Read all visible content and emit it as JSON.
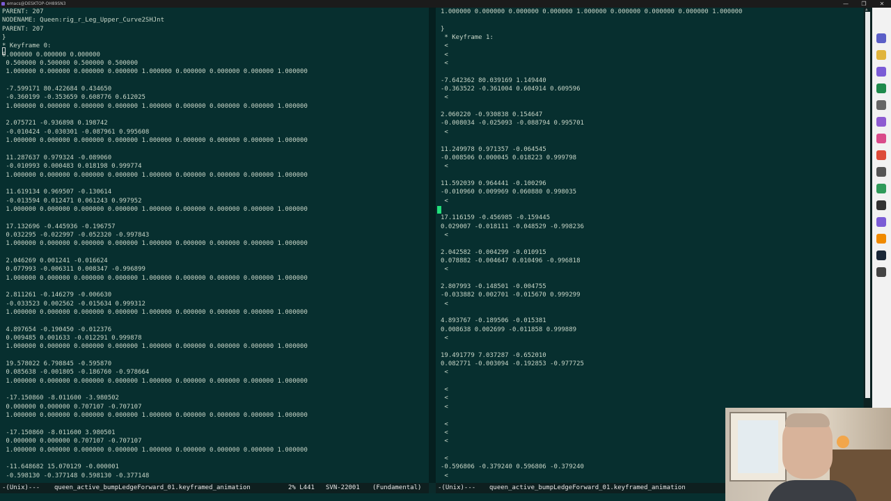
{
  "window": {
    "title": "emacs@DESKTOP-OH89SN3",
    "controls": [
      "—",
      "❐",
      "✕"
    ]
  },
  "left_pane": {
    "lines": [
      "PARENT: 207",
      "NODENAME: Queen:rig_r_Leg_Upper_Curve2SHJnt",
      "PARENT: 207",
      "}",
      "* Keyframe 0:",
      "0.000000 0.000000 0.000000",
      " 0.500000 0.500000 0.500000 0.500000",
      " 1.000000 0.000000 0.000000 0.000000 1.000000 0.000000 0.000000 0.000000 1.000000",
      "",
      " -7.599171 80.422684 0.434650",
      " -0.360199 -0.353659 0.608776 0.612025",
      " 1.000000 0.000000 0.000000 0.000000 1.000000 0.000000 0.000000 0.000000 1.000000",
      "",
      " 2.075721 -0.936898 0.198742",
      " -0.010424 -0.030301 -0.087961 0.995608",
      " 1.000000 0.000000 0.000000 0.000000 1.000000 0.000000 0.000000 0.000000 1.000000",
      "",
      " 11.287637 0.979324 -0.089060",
      " -0.010993 0.000483 0.018198 0.999774",
      " 1.000000 0.000000 0.000000 0.000000 1.000000 0.000000 0.000000 0.000000 1.000000",
      "",
      " 11.619134 0.969507 -0.130614",
      " -0.013594 0.012471 0.061243 0.997952",
      " 1.000000 0.000000 0.000000 0.000000 1.000000 0.000000 0.000000 0.000000 1.000000",
      "",
      " 17.132696 -0.445936 -0.196757",
      " 0.032295 -0.022997 -0.052320 -0.997843",
      " 1.000000 0.000000 0.000000 0.000000 1.000000 0.000000 0.000000 0.000000 1.000000",
      "",
      " 2.046269 0.001241 -0.016624",
      " 0.077993 -0.006311 0.008347 -0.996899",
      " 1.000000 0.000000 0.000000 0.000000 1.000000 0.000000 0.000000 0.000000 1.000000",
      "",
      " 2.811261 -0.146279 -0.006630",
      " -0.033523 0.002562 -0.015634 0.999312",
      " 1.000000 0.000000 0.000000 0.000000 1.000000 0.000000 0.000000 0.000000 1.000000",
      "",
      " 4.897654 -0.190450 -0.012376",
      " 0.009485 0.001633 -0.012291 0.999878",
      " 1.000000 0.000000 0.000000 0.000000 1.000000 0.000000 0.000000 0.000000 1.000000",
      "",
      " 19.578022 6.798845 -0.595870",
      " 0.085638 -0.001805 -0.186760 -0.978664",
      " 1.000000 0.000000 0.000000 0.000000 1.000000 0.000000 0.000000 0.000000 1.000000",
      "",
      " -17.150860 -8.011600 -3.980502",
      " 0.000000 0.000000 0.707107 -0.707107",
      " 1.000000 0.000000 0.000000 0.000000 1.000000 0.000000 0.000000 0.000000 1.000000",
      "",
      " -17.150860 -8.011600 3.980501",
      " 0.000000 0.000000 0.707107 -0.707107",
      " 1.000000 0.000000 0.000000 0.000000 1.000000 0.000000 0.000000 0.000000 1.000000",
      "",
      " -11.648682 15.070129 -0.000001",
      " -0.598130 -0.377148 0.598130 -0.377148"
    ]
  },
  "right_pane": {
    "lines": [
      "1.000000 0.000000 0.000000 0.000000 1.000000 0.000000 0.000000 0.000000 1.000000",
      "",
      "}",
      " * Keyframe 1:",
      " <",
      " <",
      " <",
      "",
      "-7.642362 80.039169 1.149440",
      "-0.363522 -0.361004 0.604914 0.609596",
      " <",
      "",
      "2.060220 -0.930838 0.154647",
      "-0.008034 -0.025093 -0.088794 0.995701",
      " <",
      "",
      "11.249978 0.971357 -0.064545",
      "-0.008506 0.000045 0.018223 0.999798",
      " <",
      "",
      "11.592039 0.964441 -0.100296",
      "-0.010960 0.009969 0.060880 0.998035",
      " <",
      "",
      "17.116159 -0.456985 -0.159445",
      "0.029007 -0.018111 -0.048529 -0.998236",
      " <",
      "",
      "2.042582 -0.004299 -0.010915",
      "0.078882 -0.004647 0.010496 -0.996818",
      " <",
      "",
      "2.807993 -0.148501 -0.004755",
      "-0.033882 0.002701 -0.015670 0.999299",
      " <",
      "",
      "4.893767 -0.189506 -0.015381",
      "0.008638 0.002699 -0.011858 0.999889",
      " <",
      "",
      "19.491779 7.037287 -0.652010",
      "0.082771 -0.003094 -0.192853 -0.977725",
      " <",
      "",
      " <",
      " <",
      " <",
      "",
      " <",
      " <",
      " <",
      "",
      " <",
      "-0.596806 -0.379240 0.596806 -0.379240",
      " <"
    ]
  },
  "modeline_left": {
    "status": "-(Unix)---",
    "buffer": "queen_active_bumpLedgeForward_01.keyframed_animation",
    "position": "2% L441",
    "vcs": "SVN-22001",
    "mode": "(Fundamental)"
  },
  "modeline_right": {
    "status": "-(Unix)---",
    "buffer": "queen_active_bumpLedgeForward_01.keyframed_animation"
  },
  "taskbar_icons": [
    {
      "name": "teams-icon",
      "color": "#5b5fc7"
    },
    {
      "name": "folder-icon",
      "color": "#e0b43c"
    },
    {
      "name": "emacs-icon",
      "color": "#7b5cd6"
    },
    {
      "name": "excel-icon",
      "color": "#1f8a4c"
    },
    {
      "name": "clock-icon",
      "color": "#666666"
    },
    {
      "name": "visual-studio-icon",
      "color": "#8e5bd1"
    },
    {
      "name": "paint-icon",
      "color": "#d94b8a"
    },
    {
      "name": "chrome-icon",
      "color": "#dd4b39"
    },
    {
      "name": "network-icon",
      "color": "#555555"
    },
    {
      "name": "terminal-icon",
      "color": "#2f9a5a"
    },
    {
      "name": "media-icon",
      "color": "#333333"
    },
    {
      "name": "emacs2-icon",
      "color": "#7b5cd6"
    },
    {
      "name": "vlc-icon",
      "color": "#f08a00"
    },
    {
      "name": "steam-icon",
      "color": "#1b2838"
    },
    {
      "name": "obs-icon",
      "color": "#444444"
    }
  ]
}
